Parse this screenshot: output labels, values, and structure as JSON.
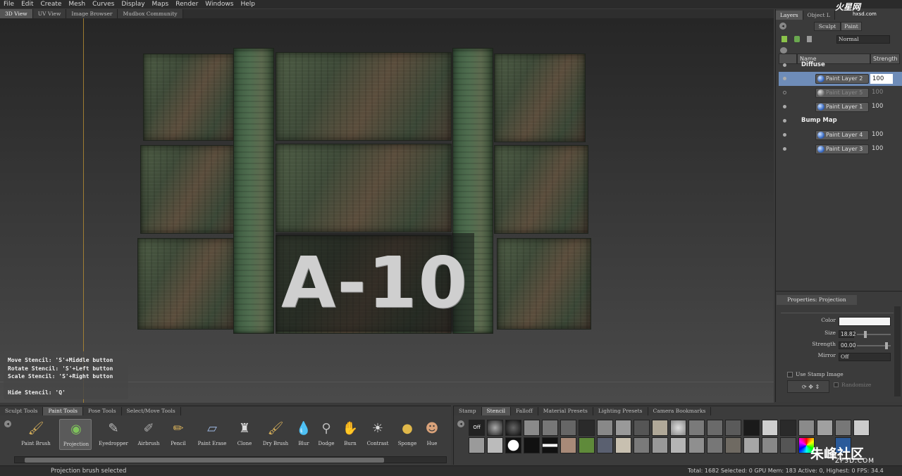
{
  "menu": [
    "File",
    "Edit",
    "Create",
    "Mesh",
    "Curves",
    "Display",
    "Maps",
    "Render",
    "Windows",
    "Help"
  ],
  "viewport_tabs": [
    "3D View",
    "UV View",
    "Image Browser",
    "Mudbox Community"
  ],
  "stencil_text": "A-10",
  "help_lines": [
    "Move Stencil: 'S'+Middle button",
    "Rotate Stencil: 'S'+Left button",
    "Scale Stencil: 'S'+Right button",
    "",
    "Hide Stencil: 'Q'"
  ],
  "right_tabs": [
    "Layers",
    "Object L",
    "..."
  ],
  "mode_buttons": {
    "sculpt": "Sculpt",
    "paint": "Paint"
  },
  "blend_mode": "Normal",
  "layers_header": {
    "name": "Name",
    "strength": "Strength"
  },
  "layers": {
    "diffuse_label": "Diffuse",
    "bump_label": "Bump Map",
    "rows": [
      {
        "name": "Paint Layer 2",
        "strength": "100"
      },
      {
        "name": "Paint Layer 5",
        "strength": "100"
      },
      {
        "name": "Paint Layer 1",
        "strength": "100"
      },
      {
        "name": "Paint Layer 4",
        "strength": "100"
      },
      {
        "name": "Paint Layer 3",
        "strength": "100"
      }
    ]
  },
  "properties": {
    "title": "Properties: Projection",
    "color_label": "Color",
    "size_label": "Size",
    "size_value": "18.82",
    "strength_label": "Strength",
    "strength_value": "00.00",
    "mirror_label": "Mirror",
    "mirror_value": "Off",
    "use_stamp": "Use Stamp Image",
    "randomize": "Randomize"
  },
  "shelf_tabs": [
    "Sculpt Tools",
    "Paint Tools",
    "Pose Tools",
    "Select/Move Tools"
  ],
  "tools": [
    "Paint Brush",
    "Projection",
    "Eyedropper",
    "Airbrush",
    "Pencil",
    "Paint Erase",
    "Clone",
    "Dry Brush",
    "Blur",
    "Dodge",
    "Burn",
    "Contrast",
    "Sponge",
    "Hue"
  ],
  "stamp_tabs": [
    "Stamp",
    "Stencil",
    "Falloff",
    "Material Presets",
    "Lighting Presets",
    "Camera Bookmarks"
  ],
  "stencil_off": "Off",
  "status_left": "Projection brush selected",
  "status_right": "Total: 1682  Selected: 0 GPU Mem: 183  Active: 0, Highest: 0  FPS: 34.4",
  "watermark_top": "火星网",
  "watermark_top_sub": "hxsd.com",
  "watermark_bottom": "朱峰社区",
  "watermark_bottom_sub": "ZF3D.COM"
}
